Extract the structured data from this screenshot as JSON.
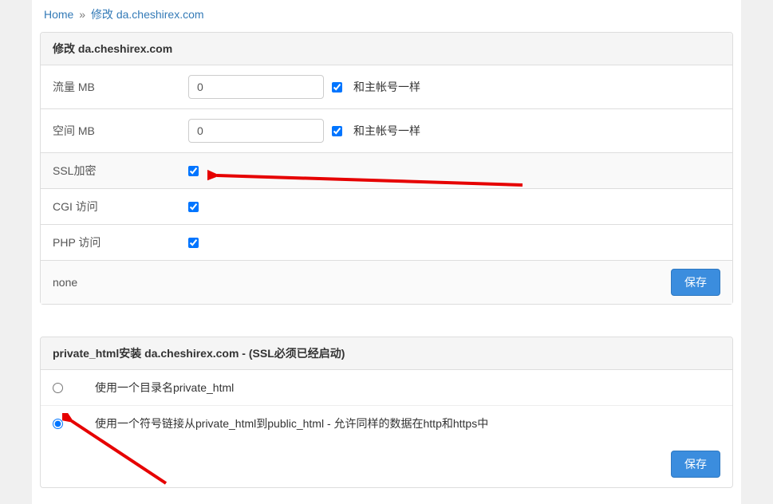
{
  "breadcrumb": {
    "home": "Home",
    "sep": "»",
    "current": "修改 da.cheshirex.com"
  },
  "panel1": {
    "heading": "修改 da.cheshirex.com",
    "traffic_label": "流量 MB",
    "traffic_value": "0",
    "same_as_main": "和主帐号一样",
    "space_label": "空间 MB",
    "space_value": "0",
    "ssl_label": "SSL加密",
    "cgi_label": "CGI 访问",
    "php_label": "PHP 访问",
    "none": "none",
    "save": "保存"
  },
  "panel2": {
    "heading": "private_html安装 da.cheshirex.com - (SSL必须已经启动)",
    "opt1": "使用一个目录名private_html",
    "opt2": "使用一个符号链接从private_html到public_html - 允许同样的数据在http和https中",
    "save": "保存"
  }
}
